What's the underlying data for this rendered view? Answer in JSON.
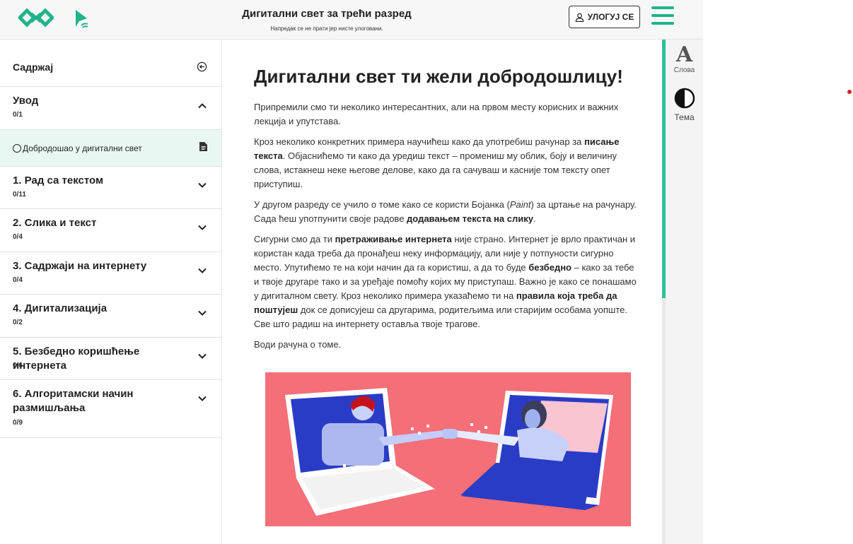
{
  "header": {
    "title": "Дигитални свет за трећи разред",
    "subtitle": "Напредак се не прати јер нисте улоговани.",
    "login_label": "УЛОГУЈ СЕ",
    "logo_icon": "petlja-logo-icon",
    "beacon_icon": "beacon-icon",
    "menu_icon": "hamburger-menu-icon",
    "accent_color": "#21b38a"
  },
  "sidebar": {
    "heading": "Садржај",
    "sections": [
      {
        "title": "Увод",
        "progress": "0/1",
        "expanded": true
      },
      {
        "title": "1. Рад са текстом",
        "progress": "0/11",
        "expanded": false
      },
      {
        "title": "2. Слика и текст",
        "progress": "0/4",
        "expanded": false
      },
      {
        "title": "3. Садржаји на интернету",
        "progress": "0/4",
        "expanded": false
      },
      {
        "title": "4. Дигитализација",
        "progress": "0/2",
        "expanded": false
      },
      {
        "title": "5. Безбедно коришћење интернета",
        "progress": "0/6",
        "expanded": false
      },
      {
        "title": "6. Алгоритамски начин размишљања",
        "progress": "0/9",
        "expanded": false
      }
    ],
    "active_lesson": "Добродошао у дигитални свет"
  },
  "article": {
    "title": "Дигитални свет ти жели добродошлицу!",
    "p1": "Припремили смо ти неколико интересантних, али на првом месту корисних и важних лекција и упутстава.",
    "p2a": "Кроз неколико конкретних примера научићеш како да употребиш рачунар за ",
    "p2b": "писање текста",
    "p2c": ". Објаснићемо ти како да уредиш текст – промениш му облик, боју и величину слова, истакнеш неке његове делове, како да га сачуваш и касније том тексту опет приступиш.",
    "p3a": "У другом разреду се учило о томе како се користи Бојанка (",
    "p3b": "Paint",
    "p3c": ") за цртање на рачунару. Сада ћеш употпунити своје радове ",
    "p3d": "додавањем текста на слику",
    "p3e": ".",
    "p4a": "Сигурни смо да ти ",
    "p4b": "претраживање интернета",
    "p4c": " није страно. Интернет је врло практичан и користан када треба да пронађеш неку информацију, али није у потпуности сигурно место. Упутићемо те на који начин да га користиш, а да то буде ",
    "p4d": "безбедно",
    "p4e": " – како за тебе и твоје другаре тако и за уређаје помоћу којих му приступаш. Важно је како се понашамо у дигиталном свету. Кроз неколико примера указаћемо ти на ",
    "p4f": "правила која треба да поштујеш",
    "p4g": " док се дописујеш са другарима, родитељима или старијим особама уопште. Све што радиш на интернету оставља твоје трагове.",
    "p5": "Води рачуна о томе.",
    "illustration": "two-laptops-handshake-illustration"
  },
  "tools": {
    "font_glyph": "A",
    "font_label": "Слова",
    "theme_label": "Тема",
    "theme_icon": "contrast-icon"
  },
  "progress_rail_color": "#2cc397"
}
